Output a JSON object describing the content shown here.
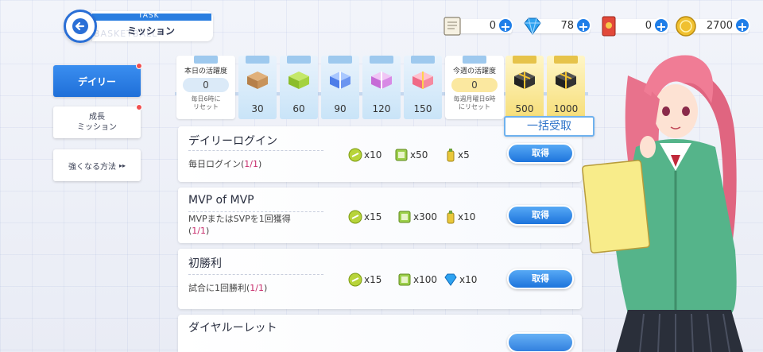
{
  "header": {
    "task_tag": "TASK",
    "title": "ミッション",
    "watermark": "BASKETBALL"
  },
  "currencies": [
    {
      "name": "ticket",
      "value": "0",
      "icon": "ticket-icon"
    },
    {
      "name": "diamond",
      "value": "78",
      "icon": "diamond-icon"
    },
    {
      "name": "card",
      "value": "0",
      "icon": "card-icon"
    },
    {
      "name": "coin",
      "value": "2700",
      "icon": "coin-icon"
    }
  ],
  "nav": {
    "daily": "デイリー",
    "growth": "成長\nミッション",
    "how_to_strengthen": "強くなる方法"
  },
  "progress": {
    "today_label": "本日の活躍度",
    "today_value": "0",
    "today_note": "毎日6時に\nリセット",
    "week_label": "今週の活躍度",
    "week_value": "0",
    "week_note": "毎週月曜日6時\nにリセット",
    "daily_rewards": [
      "30",
      "60",
      "90",
      "120",
      "150"
    ],
    "weekly_rewards": [
      "500",
      "1000"
    ]
  },
  "bulk_claim": "一括受取",
  "missions": [
    {
      "title": "デイリーログイン",
      "desc_prefix": "毎日ログイン(",
      "desc_progress": "1/1",
      "desc_suffix": ")",
      "rewards": [
        "x10",
        "x50",
        "x5"
      ],
      "button": "取得"
    },
    {
      "title": "MVP of MVP",
      "desc_prefix": "MVPまたはSVPを1回獲得",
      "desc_progress": "1/1",
      "rewards": [
        "x15",
        "x300",
        "x10"
      ],
      "button": "取得"
    },
    {
      "title": "初勝利",
      "desc_prefix": "試合に1回勝利(",
      "desc_progress": "1/1",
      "desc_suffix": ")",
      "rewards": [
        "x15",
        "x100",
        "x10"
      ],
      "button": "取得"
    },
    {
      "title": "ダイヤルーレット"
    }
  ],
  "colors": {
    "accent_blue": "#1f7ee8",
    "highlight_pink": "#c72b6a",
    "gold_card": "#f6de78"
  }
}
